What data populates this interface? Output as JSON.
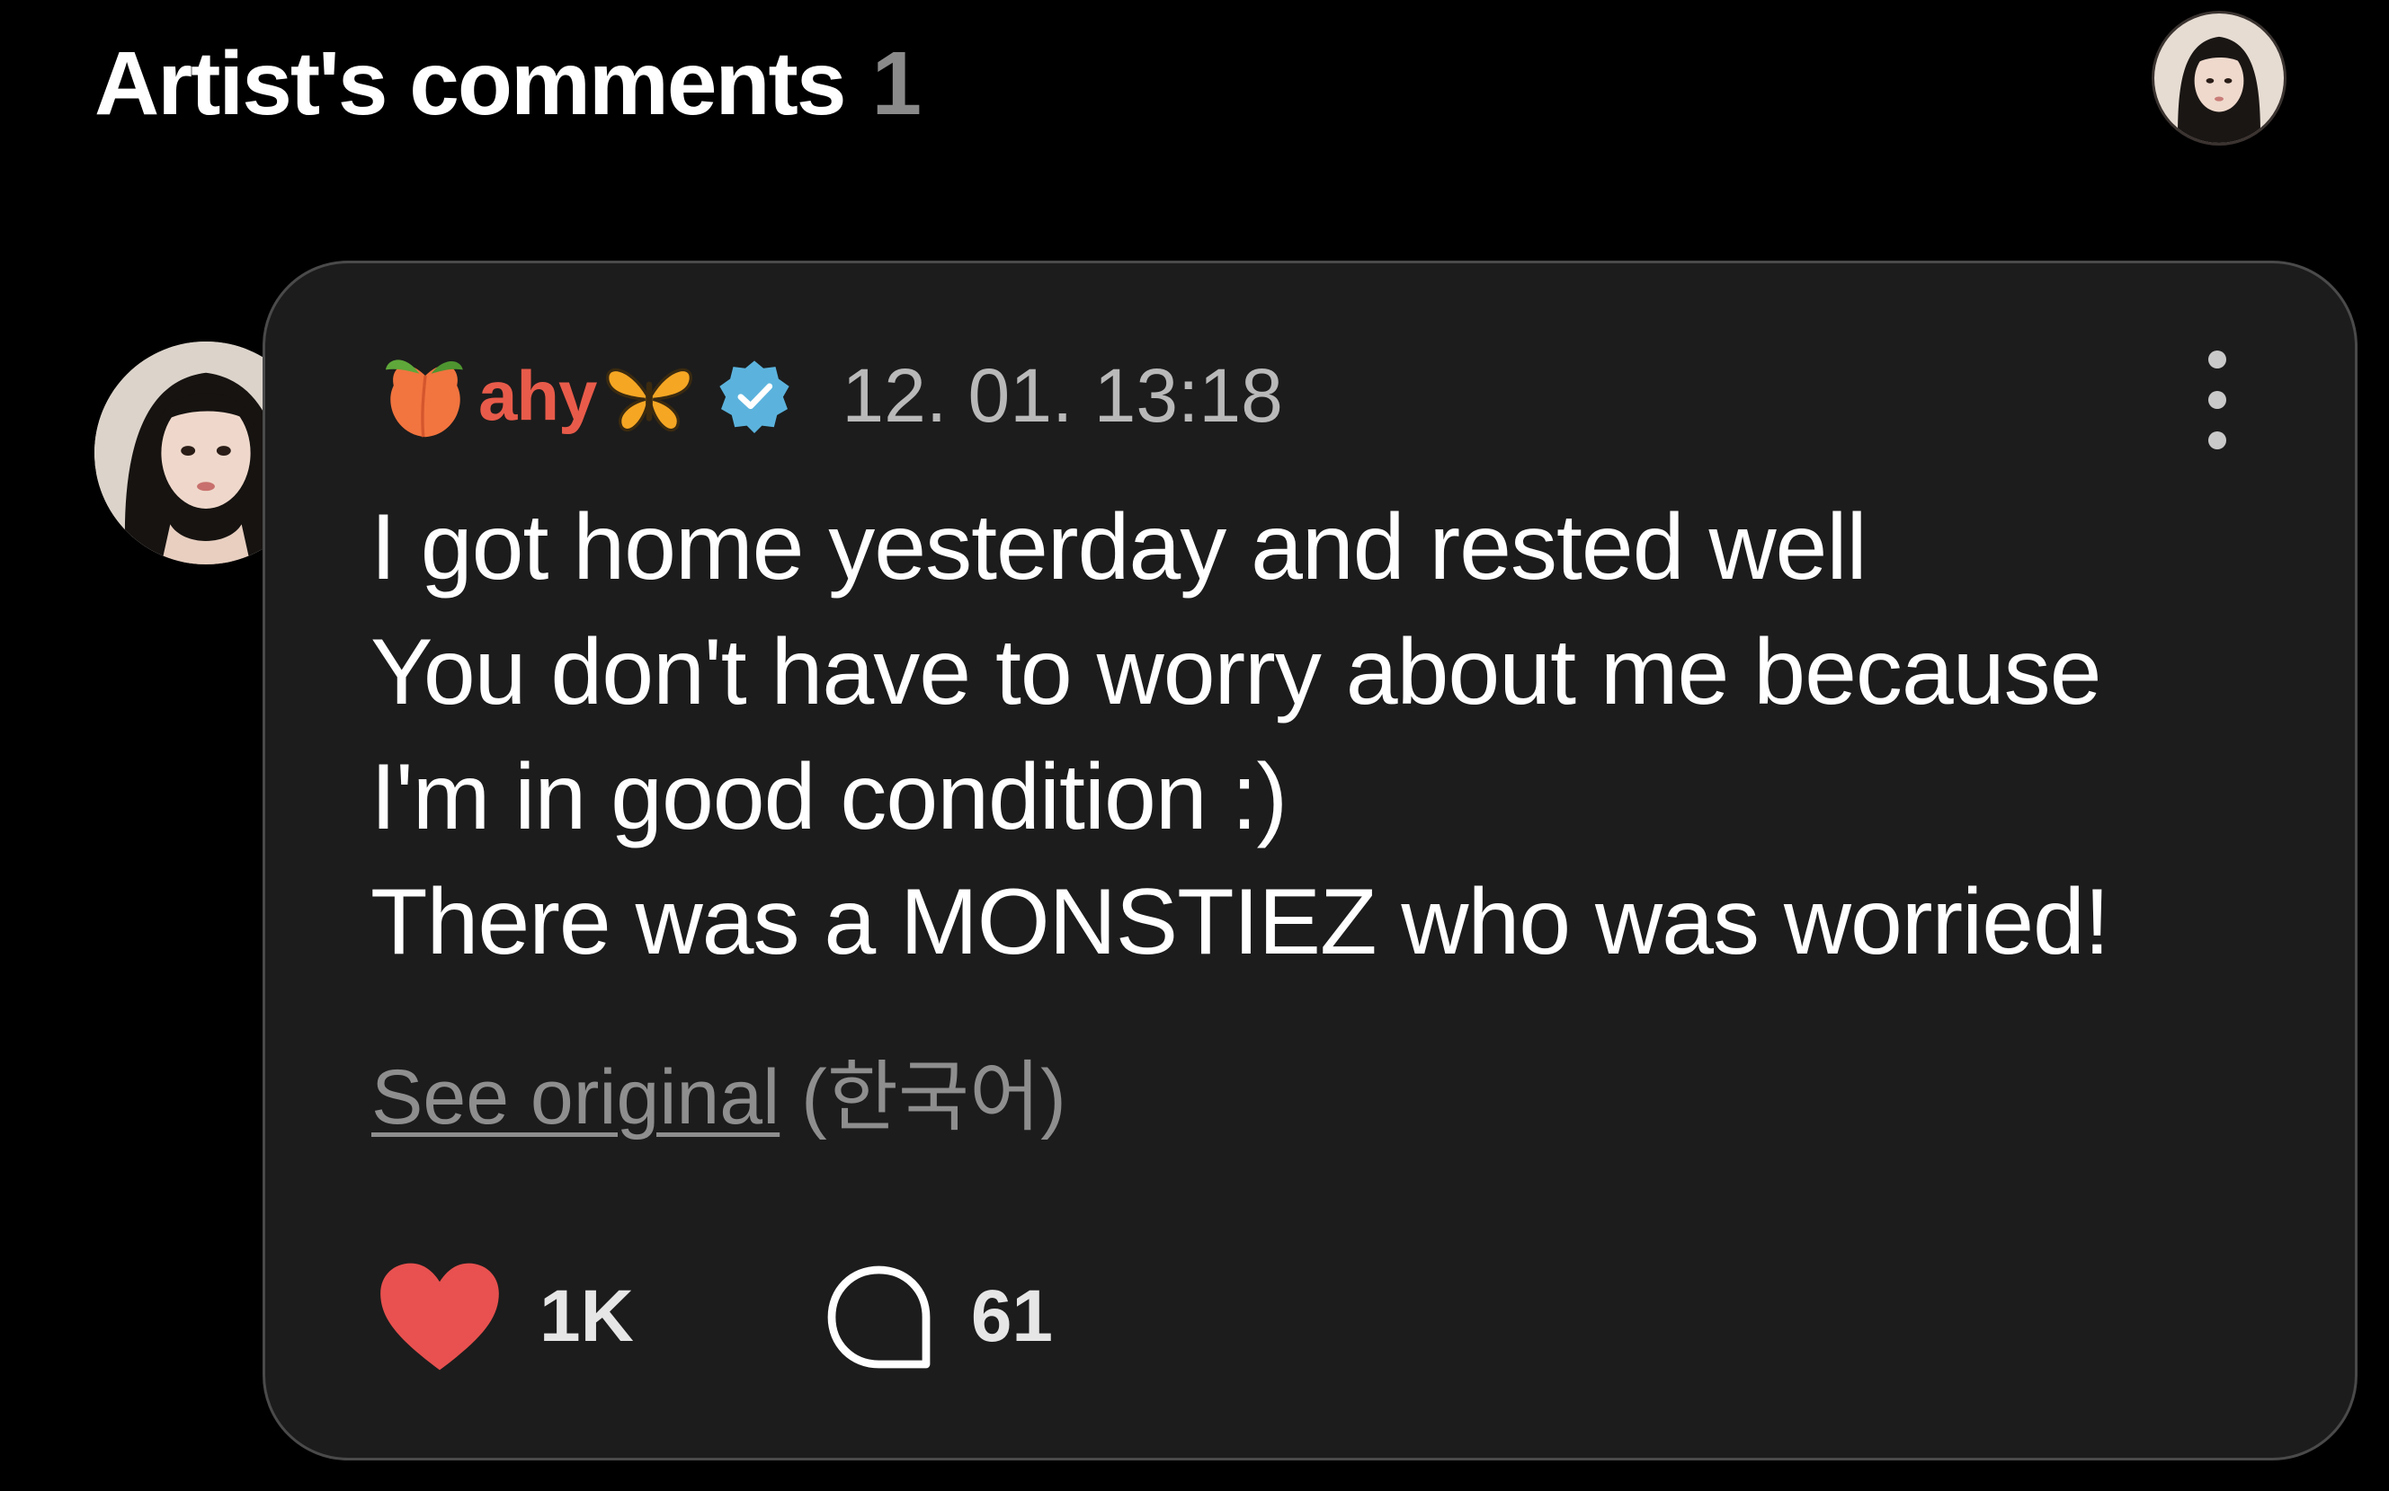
{
  "header": {
    "title": "Artist's comments",
    "count": "1"
  },
  "comment": {
    "username": "ahy",
    "name_prefix_emoji": "peach-icon",
    "name_suffix_emoji": "butterfly-icon",
    "verified": true,
    "timestamp": "12. 01. 13:18",
    "lines": [
      "I got home yesterday and rested well",
      "You don't have to worry about me because",
      "I'm in good condition :)",
      "There was a MONSTIEZ who was worried!"
    ],
    "see_original_label": "See original",
    "original_language": "(한국어)",
    "likes": "1K",
    "replies": "61"
  },
  "colors": {
    "background": "#000000",
    "card": "#1c1c1c",
    "card_border": "#4a4a4a",
    "username": "#e85b4a",
    "heart": "#e8514f",
    "verified": "#5bb3dd",
    "muted_text": "#8e8e8e"
  }
}
